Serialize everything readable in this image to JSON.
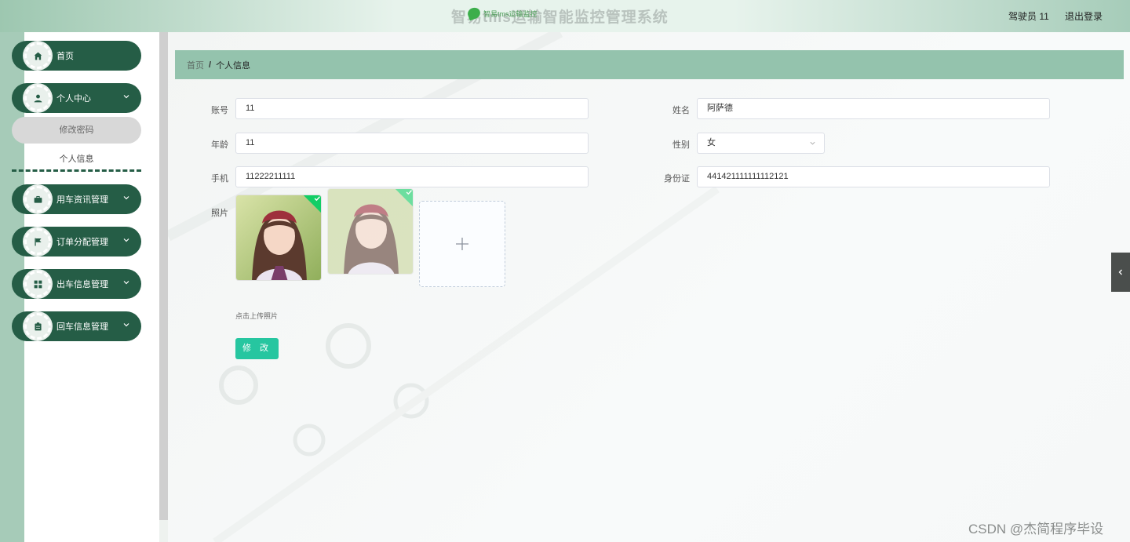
{
  "header": {
    "title": "智易tms运输智能监控管理系统",
    "logo_text": "智易tms运输监控",
    "user": "驾驶员 11",
    "logout": "退出登录"
  },
  "sidebar": {
    "items": [
      {
        "label": "首页",
        "icon": "home-icon"
      },
      {
        "label": "个人中心",
        "icon": "user-icon"
      },
      {
        "label": "用车资讯管理",
        "icon": "briefcase-icon"
      },
      {
        "label": "订单分配管理",
        "icon": "flag-icon"
      },
      {
        "label": "出车信息管理",
        "icon": "grid-icon"
      },
      {
        "label": "回车信息管理",
        "icon": "clipboard-icon"
      }
    ],
    "submenu": [
      {
        "label": "修改密码"
      },
      {
        "label": "个人信息"
      }
    ]
  },
  "breadcrumb": {
    "home": "首页",
    "separator": "/",
    "current": "个人信息"
  },
  "form": {
    "account": {
      "label": "账号",
      "value": "11"
    },
    "name": {
      "label": "姓名",
      "value": "阿萨德"
    },
    "age": {
      "label": "年龄",
      "value": "11"
    },
    "gender": {
      "label": "性别",
      "value": "女"
    },
    "phone": {
      "label": "手机",
      "value": "11222211111"
    },
    "idcard": {
      "label": "身份证",
      "value": "441421111111112121"
    },
    "photo": {
      "label": "照片",
      "tip": "点击上传照片"
    },
    "submit": "修 改"
  },
  "watermark": "CSDN @杰简程序毕设",
  "colors": {
    "sidebar_green": "#255d46",
    "breadcrumb_bg": "#94c3ad",
    "button_teal": "#26c6a0",
    "upload_check": "#13ce66"
  }
}
